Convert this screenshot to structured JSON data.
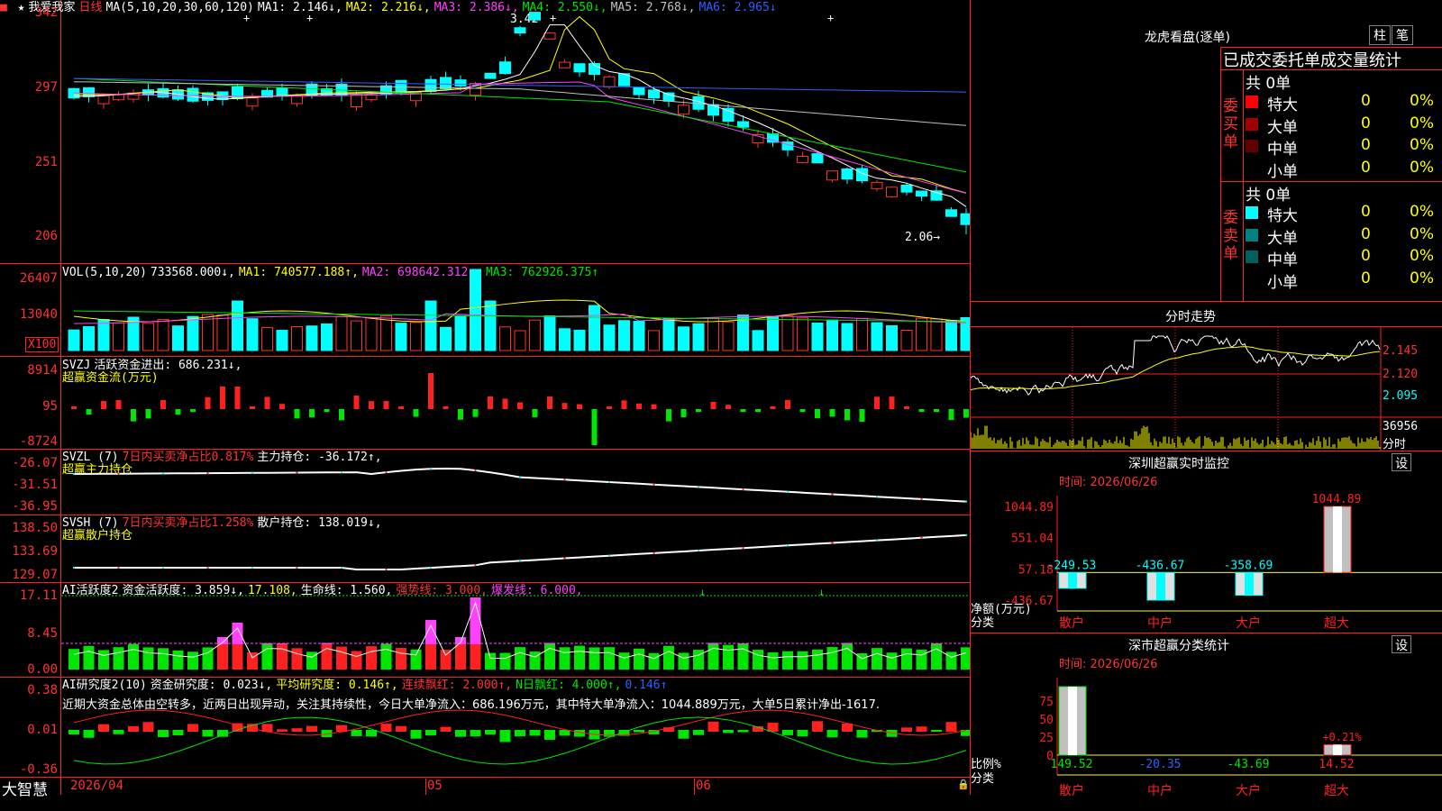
{
  "main": {
    "stock_name": "我爱我家",
    "period": "日线",
    "ma_header": "MA(5,10,20,30,60,120)",
    "ma_values": [
      {
        "label": "MA1:",
        "value": "2.146↓,",
        "color": "#ffffff"
      },
      {
        "label": "MA2:",
        "value": "2.216↓,",
        "color": "#ffff00"
      },
      {
        "label": "MA3:",
        "value": "2.386↓,",
        "color": "#ff40ff"
      },
      {
        "label": "MA4:",
        "value": "2.550↓,",
        "color": "#00e600"
      },
      {
        "label": "MA5:",
        "value": "2.768↓,",
        "color": "#c0c0c0"
      },
      {
        "label": "MA6:",
        "value": "2.965↓",
        "color": "#3060ff"
      }
    ],
    "axis_labels": [
      "342",
      "297",
      "251",
      "206"
    ],
    "high_marker": "3.42",
    "low_marker": "2.06→"
  },
  "volume": {
    "header_label": "VOL(5,10,20)",
    "value": "733568.000↓,",
    "ma1": "MA1: 740577.188↑,",
    "ma2": "MA2: 698642.312↑,",
    "ma3": "MA3: 762926.375↑",
    "axis_labels": [
      "26407",
      "13040"
    ],
    "unit": "X100"
  },
  "svzj": {
    "header": "SVZJ",
    "label": "活跃资金进出: 686.231↓,",
    "sub": "超赢资金流(万元)",
    "axis_labels": [
      "8914",
      "95",
      "-8724"
    ]
  },
  "svzl": {
    "header": "SVZL (7)",
    "ratio": "7日内买卖净占比0.817%",
    "holding": "主力持仓: -36.172↑,",
    "sub": "超赢主力持仓",
    "axis_labels": [
      "-26.07",
      "-31.51",
      "-36.95"
    ]
  },
  "svsh": {
    "header": "SVSH (7)",
    "ratio": "7日内买卖净占比1.258%",
    "holding": "散户持仓: 138.019↓,",
    "sub": "超赢散户持仓",
    "axis_labels": [
      "138.50",
      "133.69",
      "129.07"
    ]
  },
  "ai_active": {
    "header": "AI活跃度2",
    "v1": "资金活跃度: 3.859↓,",
    "v2": "17.108,",
    "v3": "生命线: 1.560,",
    "v4": "强势线: 3.000,",
    "v5": "爆发线: 6.000,",
    "axis_labels": [
      "17.11",
      "8.45",
      "0.00"
    ]
  },
  "ai_research": {
    "header": "AI研究度2(10)",
    "v1": "资金研究度: 0.023↓,",
    "v2": "平均研究度: 0.146↑,",
    "v3": "连续飘红: 2.000↑,",
    "v4": "N日飘红: 4.000↑,",
    "v5": "0.146↑",
    "comment": "近期大资金总体由空转多，近两日出现异动，关注其持续性，今日大单净流入：686.196万元，其中特大单净流入：1044.889万元，大单5日累计净出-1617.",
    "axis_labels": [
      "0.38",
      "0.01",
      "-0.36"
    ]
  },
  "footer": {
    "brand": "大智慧",
    "dates": [
      "2026/04",
      "05",
      "06"
    ]
  },
  "dragon": {
    "title": "龙虎看盘(逐单)",
    "btn1": "柱",
    "btn2": "笔",
    "subtitle": "已成交委托单成交量统计",
    "buy_side": "委买单",
    "sell_side": "委卖单",
    "buy_total": "共 0单",
    "sell_total": "共 0单",
    "buy_rows": [
      {
        "label": "特大",
        "count": "0",
        "pct": "0%",
        "color": "#ff0000"
      },
      {
        "label": "大单",
        "count": "0",
        "pct": "0%",
        "color": "#a00000"
      },
      {
        "label": "中单",
        "count": "0",
        "pct": "0%",
        "color": "#600000"
      },
      {
        "label": "小单",
        "count": "0",
        "pct": "0%",
        "color": "#000000"
      }
    ],
    "sell_rows": [
      {
        "label": "特大",
        "count": "0",
        "pct": "0%",
        "color": "#00ffff"
      },
      {
        "label": "大单",
        "count": "0",
        "pct": "0%",
        "color": "#008080"
      },
      {
        "label": "中单",
        "count": "0",
        "pct": "0%",
        "color": "#006060"
      },
      {
        "label": "小单",
        "count": "0",
        "pct": "0%",
        "color": "#000000"
      }
    ]
  },
  "intraday": {
    "title": "分时走势",
    "prices": [
      "2.145",
      "2.120",
      "2.095"
    ],
    "volume_label": "36956",
    "volume_unit": "分时"
  },
  "sz_monitor": {
    "title": "深圳超赢实时监控",
    "btn": "设",
    "time": "时间: 2026/06/26",
    "axis_labels": [
      "1044.89",
      "551.04",
      "57.18",
      "-436.67"
    ],
    "y_title1": "净额(万元)",
    "y_title2": "分类",
    "categories": [
      "散户",
      "中户",
      "大户",
      "超大"
    ],
    "value_labels": [
      "-249.53",
      "-436.67",
      "-358.69",
      "1044.89"
    ]
  },
  "sz_class": {
    "title": "深市超赢分类统计",
    "btn": "设",
    "time": "时间: 2026/06/26",
    "axis_labels": [
      "75",
      "50",
      "25",
      "0"
    ],
    "y_title1": "比例%",
    "y_title2": "分类",
    "categories": [
      "散户",
      "中户",
      "大户",
      "超大"
    ],
    "value_labels": [
      "149.52",
      "-20.35",
      "-43.69",
      "14.52"
    ],
    "pct_label": "+0.21%"
  }
}
